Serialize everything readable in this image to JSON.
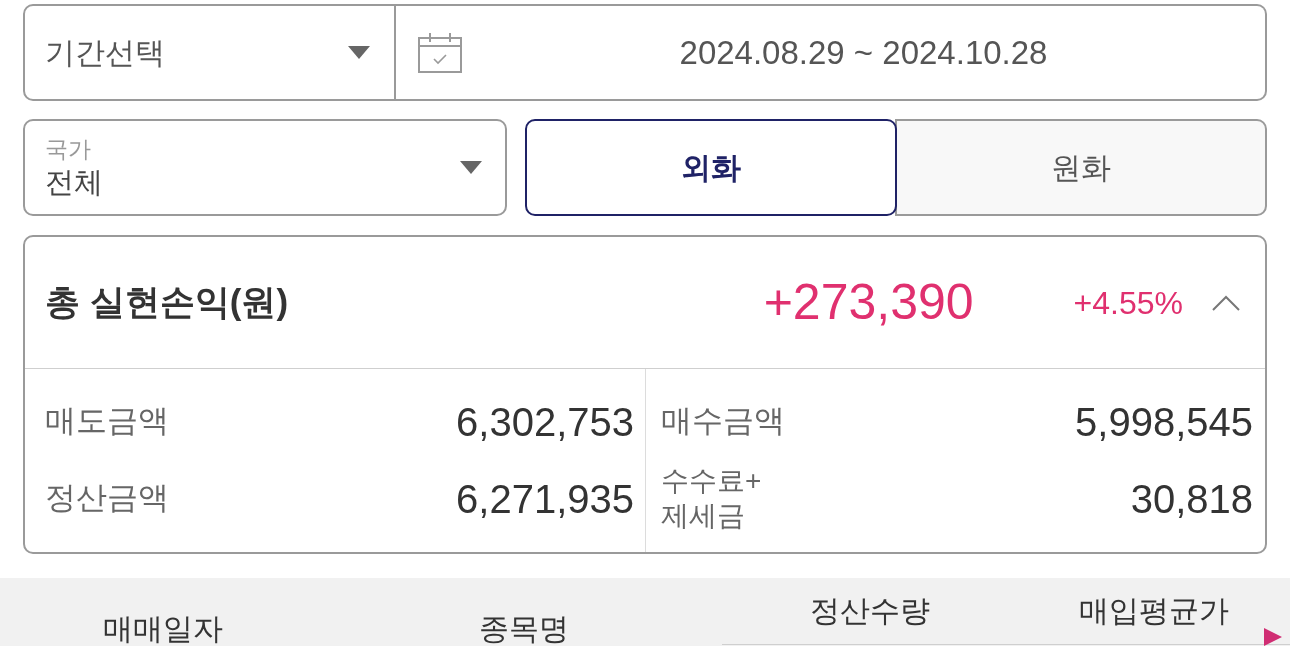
{
  "period_filter": {
    "label": "기간선택"
  },
  "date_range": {
    "value": "2024.08.29 ~ 2024.10.28"
  },
  "country_filter": {
    "label": "국가",
    "value": "전체"
  },
  "currency_tabs": [
    {
      "label": "외화",
      "selected": true
    },
    {
      "label": "원화",
      "selected": false
    }
  ],
  "summary": {
    "title": "총 실현손익(원)",
    "amount": "+273,390",
    "rate": "+4.55%",
    "expanded": true,
    "items": [
      {
        "label": "매도금액",
        "value": "6,302,753"
      },
      {
        "label": "매수금액",
        "value": "5,998,545"
      },
      {
        "label": "정산금액",
        "value": "6,271,935"
      },
      {
        "label": "수수료+\n제세금",
        "value": "30,818"
      }
    ]
  },
  "table": {
    "columns": [
      {
        "label": "매매일자",
        "kind": "rowspan"
      },
      {
        "label": "종목명",
        "kind": "rowspan"
      },
      {
        "label": "정산수량",
        "kind": "upper"
      },
      {
        "label": "매입평균가",
        "kind": "upper"
      }
    ]
  }
}
